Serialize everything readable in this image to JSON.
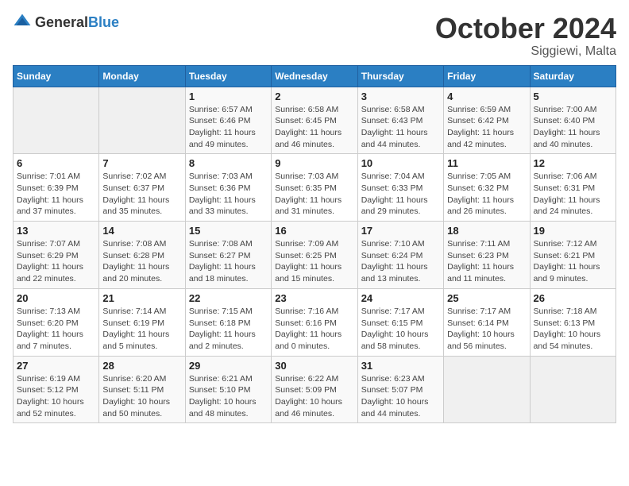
{
  "logo": {
    "general": "General",
    "blue": "Blue"
  },
  "header": {
    "month": "October 2024",
    "location": "Siggiewi, Malta"
  },
  "weekdays": [
    "Sunday",
    "Monday",
    "Tuesday",
    "Wednesday",
    "Thursday",
    "Friday",
    "Saturday"
  ],
  "weeks": [
    [
      {
        "day": "",
        "detail": ""
      },
      {
        "day": "",
        "detail": ""
      },
      {
        "day": "1",
        "detail": "Sunrise: 6:57 AM\nSunset: 6:46 PM\nDaylight: 11 hours and 49 minutes."
      },
      {
        "day": "2",
        "detail": "Sunrise: 6:58 AM\nSunset: 6:45 PM\nDaylight: 11 hours and 46 minutes."
      },
      {
        "day": "3",
        "detail": "Sunrise: 6:58 AM\nSunset: 6:43 PM\nDaylight: 11 hours and 44 minutes."
      },
      {
        "day": "4",
        "detail": "Sunrise: 6:59 AM\nSunset: 6:42 PM\nDaylight: 11 hours and 42 minutes."
      },
      {
        "day": "5",
        "detail": "Sunrise: 7:00 AM\nSunset: 6:40 PM\nDaylight: 11 hours and 40 minutes."
      }
    ],
    [
      {
        "day": "6",
        "detail": "Sunrise: 7:01 AM\nSunset: 6:39 PM\nDaylight: 11 hours and 37 minutes."
      },
      {
        "day": "7",
        "detail": "Sunrise: 7:02 AM\nSunset: 6:37 PM\nDaylight: 11 hours and 35 minutes."
      },
      {
        "day": "8",
        "detail": "Sunrise: 7:03 AM\nSunset: 6:36 PM\nDaylight: 11 hours and 33 minutes."
      },
      {
        "day": "9",
        "detail": "Sunrise: 7:03 AM\nSunset: 6:35 PM\nDaylight: 11 hours and 31 minutes."
      },
      {
        "day": "10",
        "detail": "Sunrise: 7:04 AM\nSunset: 6:33 PM\nDaylight: 11 hours and 29 minutes."
      },
      {
        "day": "11",
        "detail": "Sunrise: 7:05 AM\nSunset: 6:32 PM\nDaylight: 11 hours and 26 minutes."
      },
      {
        "day": "12",
        "detail": "Sunrise: 7:06 AM\nSunset: 6:31 PM\nDaylight: 11 hours and 24 minutes."
      }
    ],
    [
      {
        "day": "13",
        "detail": "Sunrise: 7:07 AM\nSunset: 6:29 PM\nDaylight: 11 hours and 22 minutes."
      },
      {
        "day": "14",
        "detail": "Sunrise: 7:08 AM\nSunset: 6:28 PM\nDaylight: 11 hours and 20 minutes."
      },
      {
        "day": "15",
        "detail": "Sunrise: 7:08 AM\nSunset: 6:27 PM\nDaylight: 11 hours and 18 minutes."
      },
      {
        "day": "16",
        "detail": "Sunrise: 7:09 AM\nSunset: 6:25 PM\nDaylight: 11 hours and 15 minutes."
      },
      {
        "day": "17",
        "detail": "Sunrise: 7:10 AM\nSunset: 6:24 PM\nDaylight: 11 hours and 13 minutes."
      },
      {
        "day": "18",
        "detail": "Sunrise: 7:11 AM\nSunset: 6:23 PM\nDaylight: 11 hours and 11 minutes."
      },
      {
        "day": "19",
        "detail": "Sunrise: 7:12 AM\nSunset: 6:21 PM\nDaylight: 11 hours and 9 minutes."
      }
    ],
    [
      {
        "day": "20",
        "detail": "Sunrise: 7:13 AM\nSunset: 6:20 PM\nDaylight: 11 hours and 7 minutes."
      },
      {
        "day": "21",
        "detail": "Sunrise: 7:14 AM\nSunset: 6:19 PM\nDaylight: 11 hours and 5 minutes."
      },
      {
        "day": "22",
        "detail": "Sunrise: 7:15 AM\nSunset: 6:18 PM\nDaylight: 11 hours and 2 minutes."
      },
      {
        "day": "23",
        "detail": "Sunrise: 7:16 AM\nSunset: 6:16 PM\nDaylight: 11 hours and 0 minutes."
      },
      {
        "day": "24",
        "detail": "Sunrise: 7:17 AM\nSunset: 6:15 PM\nDaylight: 10 hours and 58 minutes."
      },
      {
        "day": "25",
        "detail": "Sunrise: 7:17 AM\nSunset: 6:14 PM\nDaylight: 10 hours and 56 minutes."
      },
      {
        "day": "26",
        "detail": "Sunrise: 7:18 AM\nSunset: 6:13 PM\nDaylight: 10 hours and 54 minutes."
      }
    ],
    [
      {
        "day": "27",
        "detail": "Sunrise: 6:19 AM\nSunset: 5:12 PM\nDaylight: 10 hours and 52 minutes."
      },
      {
        "day": "28",
        "detail": "Sunrise: 6:20 AM\nSunset: 5:11 PM\nDaylight: 10 hours and 50 minutes."
      },
      {
        "day": "29",
        "detail": "Sunrise: 6:21 AM\nSunset: 5:10 PM\nDaylight: 10 hours and 48 minutes."
      },
      {
        "day": "30",
        "detail": "Sunrise: 6:22 AM\nSunset: 5:09 PM\nDaylight: 10 hours and 46 minutes."
      },
      {
        "day": "31",
        "detail": "Sunrise: 6:23 AM\nSunset: 5:07 PM\nDaylight: 10 hours and 44 minutes."
      },
      {
        "day": "",
        "detail": ""
      },
      {
        "day": "",
        "detail": ""
      }
    ]
  ]
}
